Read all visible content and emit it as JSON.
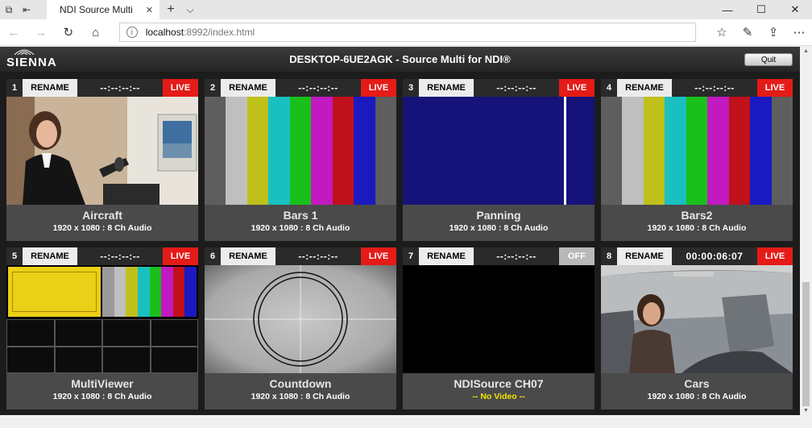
{
  "browser": {
    "tab_title": "NDI Source Multi",
    "tab_close": "✕",
    "new_tab": "+",
    "tab_menu": "⌵",
    "address_host": "localhost",
    "address_path": ":8992/index.html",
    "window": {
      "minimize": "—",
      "maximize": "☐",
      "close": "✕"
    },
    "icons": {
      "back": "arrow-left-icon",
      "forward": "arrow-right-icon",
      "refresh": "refresh-icon",
      "home": "home-icon",
      "favorites": "star-icon",
      "notes": "pen-icon",
      "share": "share-icon",
      "more": "more-icon"
    }
  },
  "app": {
    "logo": "SIENNA",
    "title": "DESKTOP-6UE2AGK - Source Multi for NDI®",
    "quit_label": "Quit"
  },
  "tiles": [
    {
      "num": "1",
      "rename": "RENAME",
      "timecode": "--:--:--:--",
      "status": "LIVE",
      "name": "Aircraft",
      "info": "1920 x 1080 : 8 Ch Audio"
    },
    {
      "num": "2",
      "rename": "RENAME",
      "timecode": "--:--:--:--",
      "status": "LIVE",
      "name": "Bars 1",
      "info": "1920 x 1080 : 8 Ch Audio"
    },
    {
      "num": "3",
      "rename": "RENAME",
      "timecode": "--:--:--:--",
      "status": "LIVE",
      "name": "Panning",
      "info": "1920 x 1080 : 8 Ch Audio"
    },
    {
      "num": "4",
      "rename": "RENAME",
      "timecode": "--:--:--:--",
      "status": "LIVE",
      "name": "Bars2",
      "info": "1920 x 1080 : 8 Ch Audio"
    },
    {
      "num": "5",
      "rename": "RENAME",
      "timecode": "--:--:--:--",
      "status": "LIVE",
      "name": "MultiViewer",
      "info": "1920 x 1080 : 8 Ch Audio"
    },
    {
      "num": "6",
      "rename": "RENAME",
      "timecode": "--:--:--:--",
      "status": "LIVE",
      "name": "Countdown",
      "info": "1920 x 1080 : 8 Ch Audio"
    },
    {
      "num": "7",
      "rename": "RENAME",
      "timecode": "--:--:--:--",
      "status": "OFF",
      "name": "NDISource CH07",
      "info": "-- No Video --"
    },
    {
      "num": "8",
      "rename": "RENAME",
      "timecode": "00:00:06:07",
      "status": "LIVE",
      "name": "Cars",
      "info": "1920 x 1080 : 8 Ch Audio"
    }
  ],
  "colors": {
    "live": "#e41b17",
    "off": "#b9b9b9",
    "bars": [
      "#bfbfbf",
      "#c0c01a",
      "#1ac0c0",
      "#1ac01a",
      "#c01ac0",
      "#c0101a",
      "#1a1ac0"
    ],
    "panning_bg": "#15137a",
    "no_video_text": "#f3e600"
  }
}
